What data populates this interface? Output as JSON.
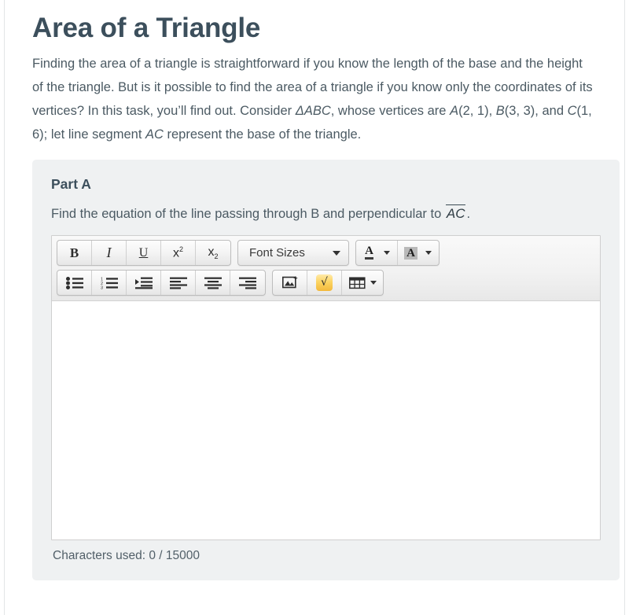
{
  "page": {
    "title": "Area of a Triangle",
    "intro_parts": [
      {
        "text": "Finding the area of a triangle is straightforward if you know the length of the base and the height of the triangle. But is it possible to find the area of a triangle if you know only the coordinates of its vertices? In this task, you’ll find out. Consider ",
        "style": "normal"
      },
      {
        "text": "ΔABC",
        "style": "italic"
      },
      {
        "text": ", whose vertices are ",
        "style": "normal"
      },
      {
        "text": "A",
        "style": "italic"
      },
      {
        "text": "(2, 1), ",
        "style": "normal"
      },
      {
        "text": "B",
        "style": "italic"
      },
      {
        "text": "(3, 3), and ",
        "style": "normal"
      },
      {
        "text": "C",
        "style": "italic"
      },
      {
        "text": "(1, 6); let line segment ",
        "style": "normal"
      },
      {
        "text": "AC",
        "style": "italic"
      },
      {
        "text": " represent the base of the triangle.",
        "style": "normal"
      }
    ]
  },
  "part_a": {
    "heading": "Part A",
    "prompt_before": "Find the equation of the line passing through B and perpendicular to ",
    "prompt_overline": "AC",
    "prompt_after": ".",
    "char_count": "Characters used: 0 / 15000"
  },
  "editor": {
    "answer_value": "",
    "answer_placeholder": "",
    "toolbar_row1": [
      {
        "name": "bold-button",
        "label": "B",
        "icon": "bold-icon"
      },
      {
        "name": "italic-button",
        "label": "I",
        "icon": "italic-icon"
      },
      {
        "name": "underline-button",
        "label": "U",
        "icon": "underline-icon"
      },
      {
        "name": "superscript-button",
        "label": "x²",
        "icon": "superscript-icon"
      },
      {
        "name": "subscript-button",
        "label": "x₂",
        "icon": "subscript-icon"
      }
    ],
    "font_size_select": {
      "label": "Font Sizes",
      "icon": "chevron-down-icon"
    },
    "text_color_button": {
      "label": "A",
      "icon": "text-color-icon",
      "swatch": "#3d3d3d"
    },
    "background_color_button": {
      "label": "A",
      "icon": "background-color-icon",
      "swatch": "#b9b9b9"
    },
    "toolbar_row2": [
      {
        "name": "bullet-list-button",
        "icon": "bullet-list-icon"
      },
      {
        "name": "numbered-list-button",
        "icon": "numbered-list-icon"
      },
      {
        "name": "indent-button",
        "icon": "indent-icon"
      },
      {
        "name": "align-left-button",
        "icon": "align-left-icon"
      },
      {
        "name": "align-center-button",
        "icon": "align-center-icon"
      },
      {
        "name": "align-right-button",
        "icon": "align-right-icon"
      }
    ],
    "insert_image_button": {
      "icon": "image-icon"
    },
    "equation_button": {
      "icon": "square-root-icon",
      "glyph": "√",
      "color": "#f3b93c"
    },
    "table_button": {
      "icon": "table-icon"
    }
  },
  "colors": {
    "title": "#3c4f5c",
    "body_text": "#4b5a63",
    "panel_bg": "#eff1f2",
    "toolbar_bg": "#f2f2f2",
    "border": "#cfcfcf"
  }
}
